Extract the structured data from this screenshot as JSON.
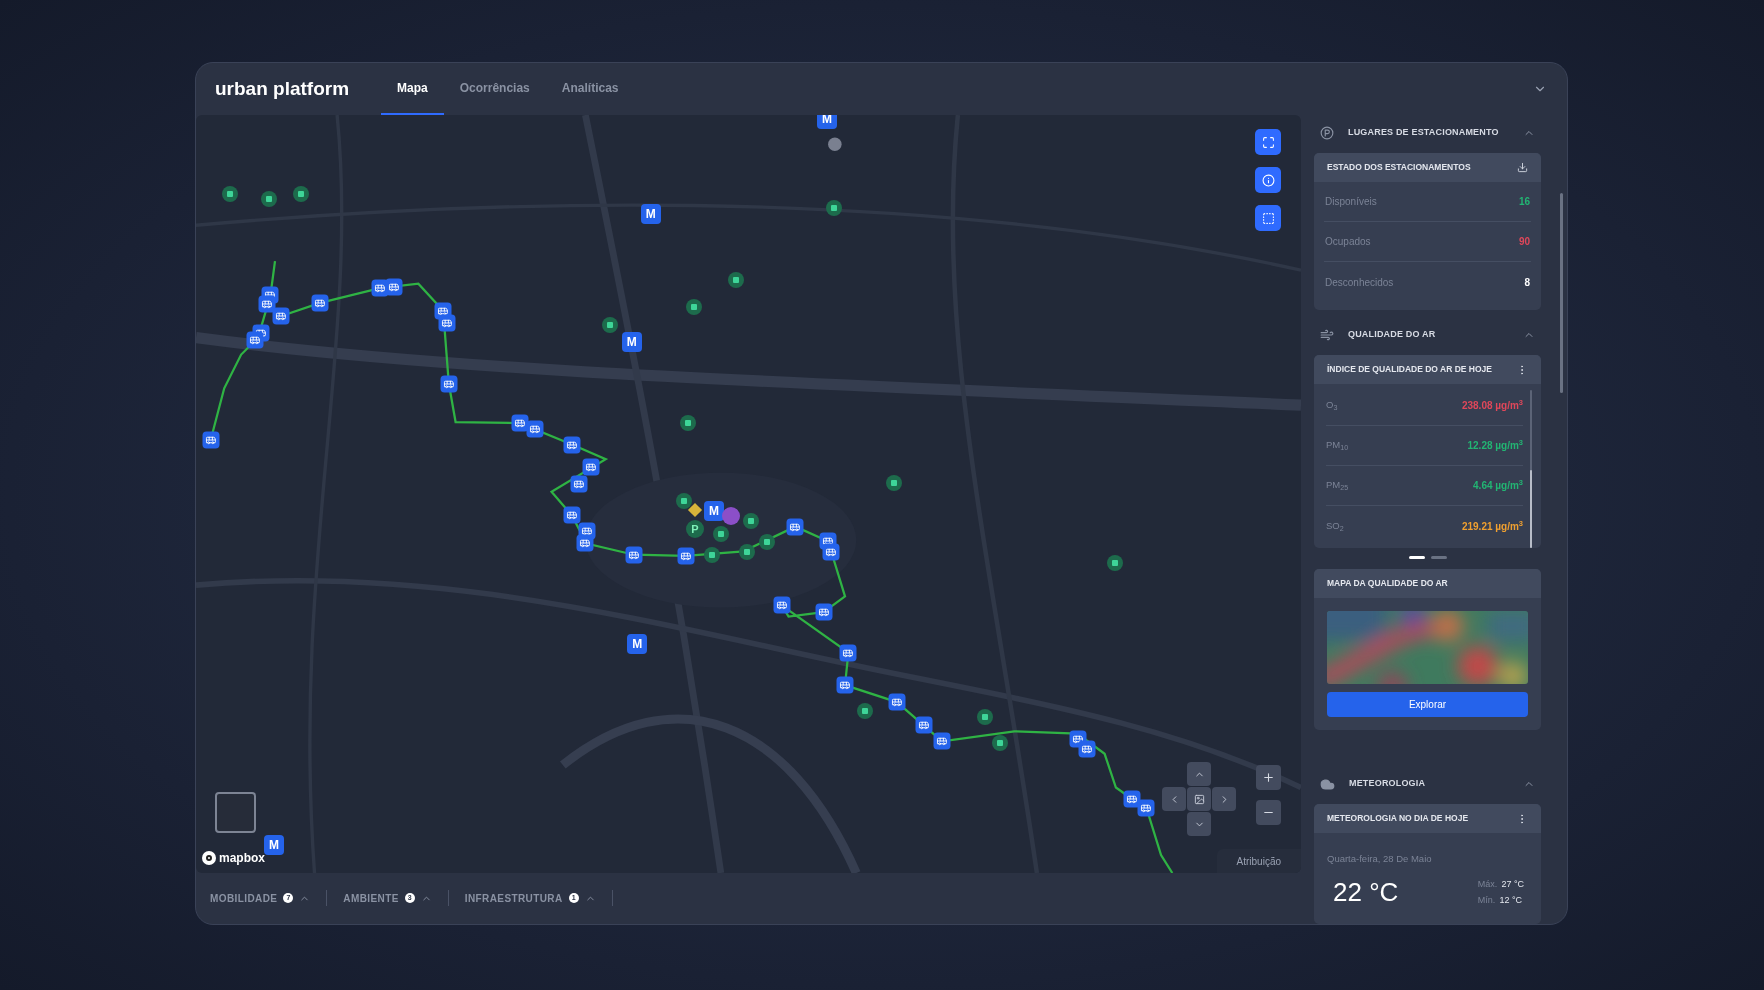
{
  "header": {
    "logo": "urban platform",
    "tabs": [
      {
        "label": "Mapa",
        "selected": true
      },
      {
        "label": "Ocorrências",
        "selected": false
      },
      {
        "label": "Analíticas",
        "selected": false
      }
    ]
  },
  "map": {
    "markers": [
      {
        "kind": "bus"
      },
      {
        "kind": "bus"
      },
      {
        "kind": "bus"
      },
      {
        "kind": "bus"
      },
      {
        "kind": "bus"
      },
      {
        "kind": "bus"
      },
      {
        "kind": "bus"
      },
      {
        "kind": "bus"
      },
      {
        "kind": "bus"
      },
      {
        "kind": "bus"
      },
      {
        "kind": "bus"
      },
      {
        "kind": "bus"
      },
      {
        "kind": "bus"
      },
      {
        "kind": "bus"
      },
      {
        "kind": "bus"
      },
      {
        "kind": "bus"
      },
      {
        "kind": "bus"
      },
      {
        "kind": "bus"
      },
      {
        "kind": "bus"
      },
      {
        "kind": "bus"
      },
      {
        "kind": "bus"
      },
      {
        "kind": "bus"
      },
      {
        "kind": "bus"
      },
      {
        "kind": "bus"
      },
      {
        "kind": "bus"
      },
      {
        "kind": "bus"
      },
      {
        "kind": "bus"
      },
      {
        "kind": "bus"
      },
      {
        "kind": "bus"
      },
      {
        "kind": "bus"
      },
      {
        "kind": "bus"
      },
      {
        "kind": "bus"
      },
      {
        "kind": "bus"
      },
      {
        "kind": "bus"
      },
      {
        "kind": "bus"
      },
      {
        "kind": "bus"
      },
      {
        "kind": "metro",
        "label": "M"
      },
      {
        "kind": "metro",
        "label": "M"
      },
      {
        "kind": "metro",
        "label": "M"
      },
      {
        "kind": "metro",
        "label": "M"
      },
      {
        "kind": "metro",
        "label": "M"
      },
      {
        "kind": "metro",
        "label": "M"
      },
      {
        "kind": "green"
      },
      {
        "kind": "green"
      },
      {
        "kind": "green"
      },
      {
        "kind": "green"
      },
      {
        "kind": "green"
      },
      {
        "kind": "green"
      },
      {
        "kind": "green"
      },
      {
        "kind": "green"
      },
      {
        "kind": "green"
      },
      {
        "kind": "green"
      },
      {
        "kind": "green"
      },
      {
        "kind": "green"
      },
      {
        "kind": "green"
      },
      {
        "kind": "green"
      },
      {
        "kind": "green"
      },
      {
        "kind": "green"
      },
      {
        "kind": "green"
      },
      {
        "kind": "green"
      },
      {
        "kind": "green"
      },
      {
        "kind": "parking",
        "label": "P"
      },
      {
        "kind": "poi"
      },
      {
        "kind": "alert"
      }
    ],
    "logo": "mapbox",
    "attribution": "Atribuição"
  },
  "layers": [
    {
      "label": "MOBILIDADE",
      "count": "7"
    },
    {
      "label": "AMBIENTE",
      "count": "3"
    },
    {
      "label": "INFRAESTRUTURA",
      "count": "1"
    }
  ],
  "panel": {
    "parking": {
      "title": "LUGARES DE ESTACIONAMENTO",
      "card_title": "ESTADO DOS ESTACIONAMENTOS",
      "rows": [
        {
          "label": "Disponíveis",
          "value": "16",
          "color": "#22b573"
        },
        {
          "label": "Ocupados",
          "value": "90",
          "color": "#e0475a"
        },
        {
          "label": "Desconhecidos",
          "value": "8",
          "color": "#ffffff"
        }
      ]
    },
    "air": {
      "title": "QUALIDADE DO AR",
      "card_title": "ÍNDICE DE QUALIDADE DO AR DE HOJE",
      "rows": [
        {
          "label": "O$_{3}$",
          "value": "238.08 µg/m$^{3}$",
          "color": "#e0475a"
        },
        {
          "label": "PM$_{10}$",
          "value": "12.28 µg/m$^{3}$",
          "color": "#22b573"
        },
        {
          "label": "PM$_{25}$",
          "value": "4.64 µg/m$^{3}$",
          "color": "#22b573"
        },
        {
          "label": "SO$_{2}$",
          "value": "219.21 µg/m$^{3}$",
          "color": "#f0a030"
        }
      ],
      "pages": [
        {
          "selected": true
        },
        {
          "selected": false
        }
      ],
      "map_title": "MAPA DA QUALIDADE DO AR",
      "button": "Explorar"
    },
    "weather": {
      "title": "METEOROLOGIA",
      "card_title": "METEOROLOGIA NO DIA DE HOJE",
      "date": "Quarta-feira, 28 De Maio",
      "temp": "22 °C",
      "max_label": "Máx.",
      "max": "27 °C",
      "min_label": "Mín.",
      "min": "12 °C"
    }
  }
}
